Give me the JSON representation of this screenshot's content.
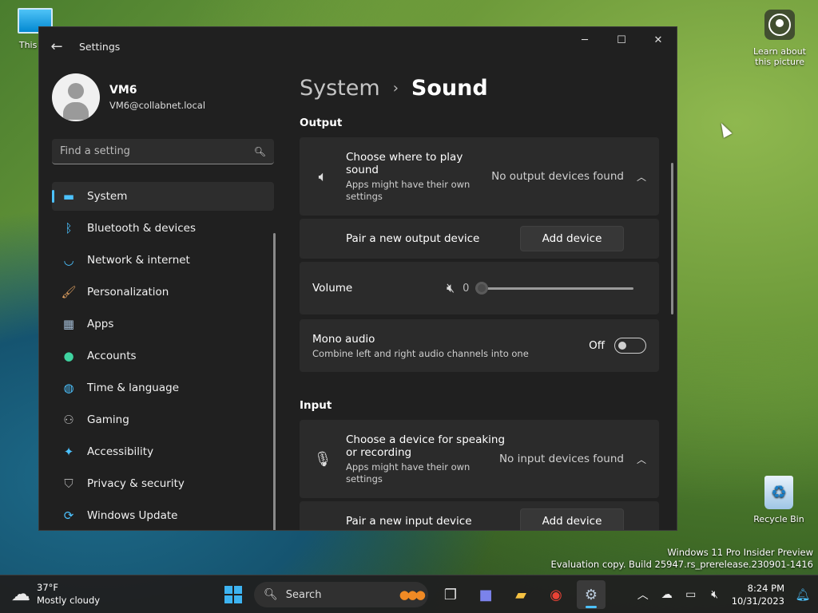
{
  "desktop": {
    "this_pc": "This PC",
    "learn_line1": "Learn about",
    "learn_line2": "this picture",
    "recycle_bin": "Recycle Bin",
    "watermark_line1": "Windows 11 Pro Insider Preview",
    "watermark_line2": "Evaluation copy. Build 25947.rs_prerelease.230901-1416"
  },
  "window": {
    "title": "Settings",
    "back_icon": "arrow-left-icon",
    "minimize": "minimize-icon",
    "maximize": "maximize-icon",
    "close": "close-icon"
  },
  "profile": {
    "name": "VM6",
    "email": "VM6@collabnet.local"
  },
  "search": {
    "placeholder": "Find a setting"
  },
  "nav": [
    {
      "label": "System",
      "icon": "monitor-icon",
      "active": true
    },
    {
      "label": "Bluetooth & devices",
      "icon": "bluetooth-icon"
    },
    {
      "label": "Network & internet",
      "icon": "wifi-icon"
    },
    {
      "label": "Personalization",
      "icon": "brush-icon"
    },
    {
      "label": "Apps",
      "icon": "apps-icon"
    },
    {
      "label": "Accounts",
      "icon": "person-icon"
    },
    {
      "label": "Time & language",
      "icon": "globe-clock-icon"
    },
    {
      "label": "Gaming",
      "icon": "gamepad-icon"
    },
    {
      "label": "Accessibility",
      "icon": "accessibility-icon"
    },
    {
      "label": "Privacy & security",
      "icon": "shield-icon"
    },
    {
      "label": "Windows Update",
      "icon": "update-icon"
    }
  ],
  "breadcrumb": {
    "parent": "System",
    "current": "Sound"
  },
  "output": {
    "title": "Output",
    "choose_label_line1": "Choose where to play",
    "choose_label_line2": "sound",
    "choose_sub_line1": "Apps might have their own",
    "choose_sub_line2": "settings",
    "status": "No output devices found",
    "pair_label": "Pair a new output device",
    "add_button": "Add device",
    "volume_label": "Volume",
    "volume_value": "0",
    "volume_level": 0,
    "mono_label": "Mono audio",
    "mono_sub": "Combine left and right audio channels into one",
    "mono_state": "Off"
  },
  "input": {
    "title": "Input",
    "choose_label_line1": "Choose a device for speaking",
    "choose_label_line2": "or recording",
    "choose_sub_line1": "Apps might have their own",
    "choose_sub_line2": "settings",
    "status": "No input devices found",
    "pair_label": "Pair a new input device",
    "add_button": "Add device"
  },
  "taskbar": {
    "weather_temp": "37°F",
    "weather_cond": "Mostly cloudy",
    "search_label": "Search",
    "time": "8:24 PM",
    "date": "10/31/2023"
  },
  "colors": {
    "accent": "#4cc2ff",
    "window_bg": "#202020",
    "card_bg": "#2b2b2b"
  }
}
